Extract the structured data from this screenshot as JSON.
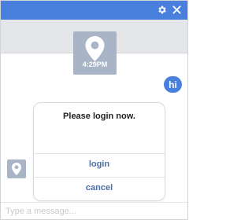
{
  "header": {
    "settings_icon": "gear-icon",
    "close_icon": "close-icon",
    "background_color": "#4a80dd"
  },
  "chat": {
    "location_message": {
      "icon": "map-pin-icon",
      "time": "4:29PM"
    },
    "user_message": {
      "text": "hi",
      "color": "#4a80dd"
    },
    "bot_avatar": {
      "icon": "map-pin-icon"
    }
  },
  "dialog": {
    "title": "Please login now.",
    "login_label": "login",
    "cancel_label": "cancel",
    "button_color": "#4a6fa8"
  },
  "composer": {
    "placeholder": "Type a message..."
  }
}
